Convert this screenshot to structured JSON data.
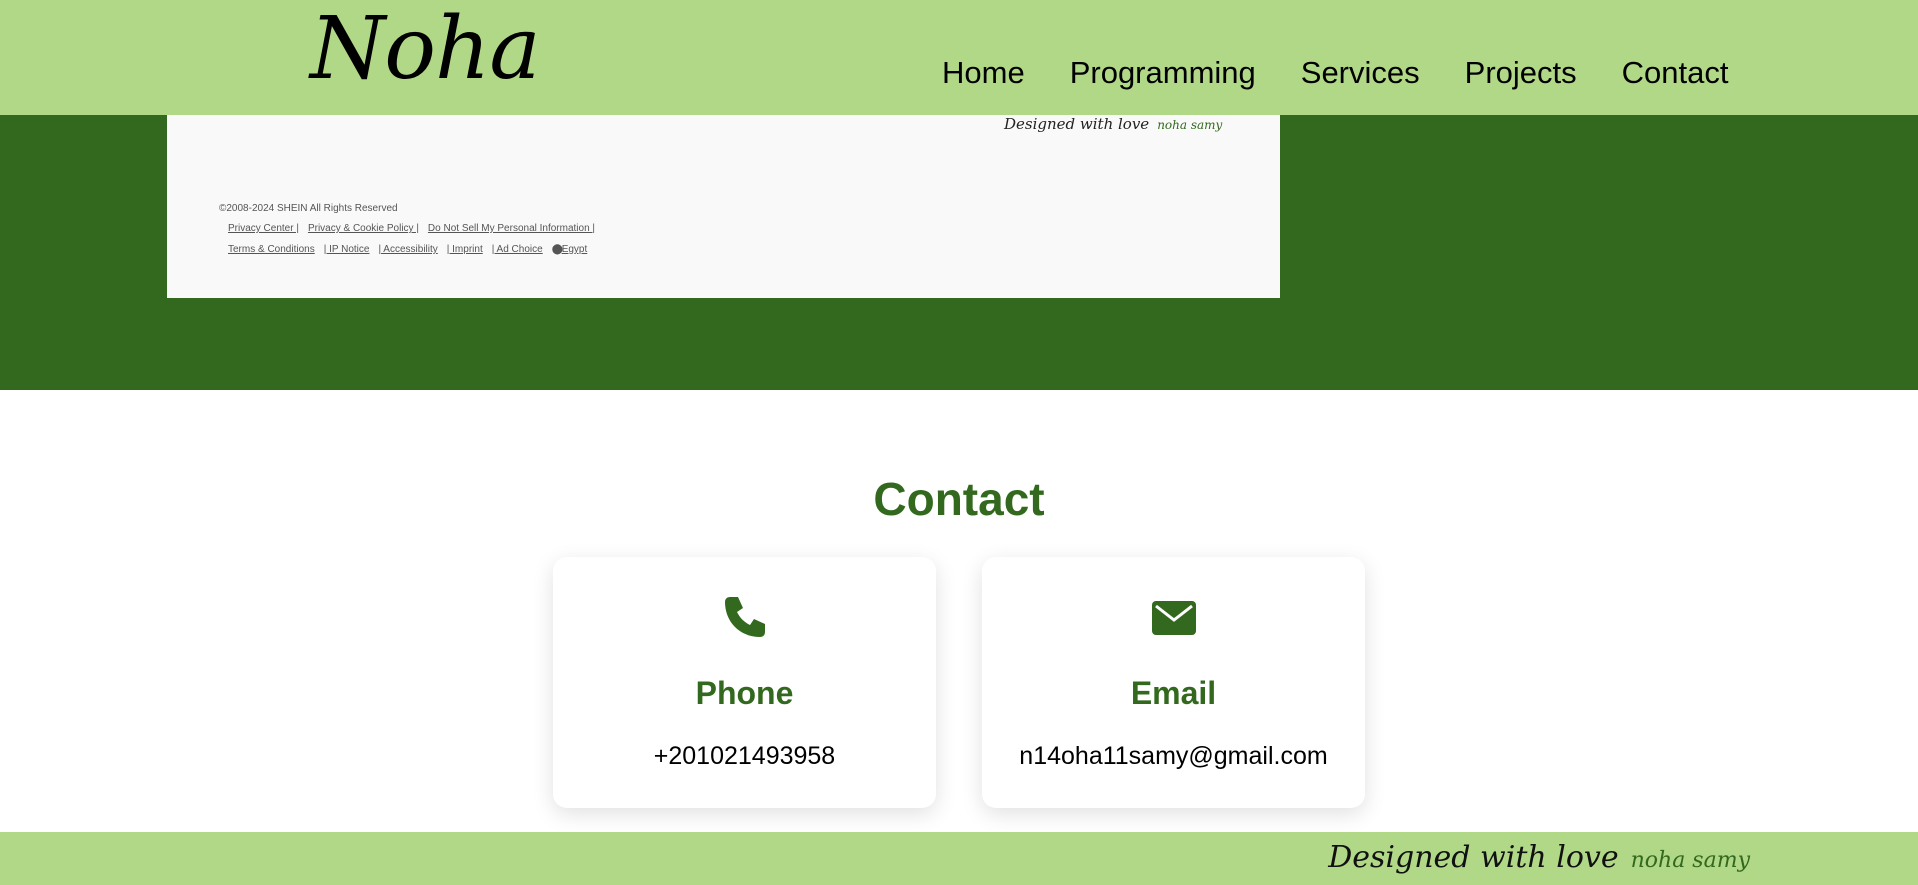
{
  "header": {
    "logo": "Noha",
    "nav": [
      {
        "label": "Home"
      },
      {
        "label": "Programming"
      },
      {
        "label": "Services"
      },
      {
        "label": "Projects"
      },
      {
        "label": "Contact"
      }
    ]
  },
  "project_preview": {
    "designed_text": "Designed with love",
    "signature": "noha samy",
    "copyright": "©2008-2024 SHEIN All Rights Reserved",
    "links_row1": [
      "Privacy Center |",
      "Privacy & Cookie Policy |",
      "Do Not Sell My Personal Information |"
    ],
    "links_row2": [
      "Terms & Conditions",
      "| IP Notice",
      "| Accessibility",
      "| Imprint",
      "| Ad Choice",
      "Egypt"
    ]
  },
  "contact": {
    "title": "Contact",
    "cards": [
      {
        "title": "Phone",
        "value": "+201021493958",
        "icon": "phone-icon"
      },
      {
        "title": "Email",
        "value": "n14oha11samy@gmail.com",
        "icon": "envelope-icon"
      }
    ]
  },
  "footer": {
    "designed_text": "Designed with love",
    "signature": "noha samy"
  },
  "colors": {
    "nav_bg": "#b0d886",
    "accent": "#33691e",
    "preview_bg": "#f9f9f9"
  }
}
